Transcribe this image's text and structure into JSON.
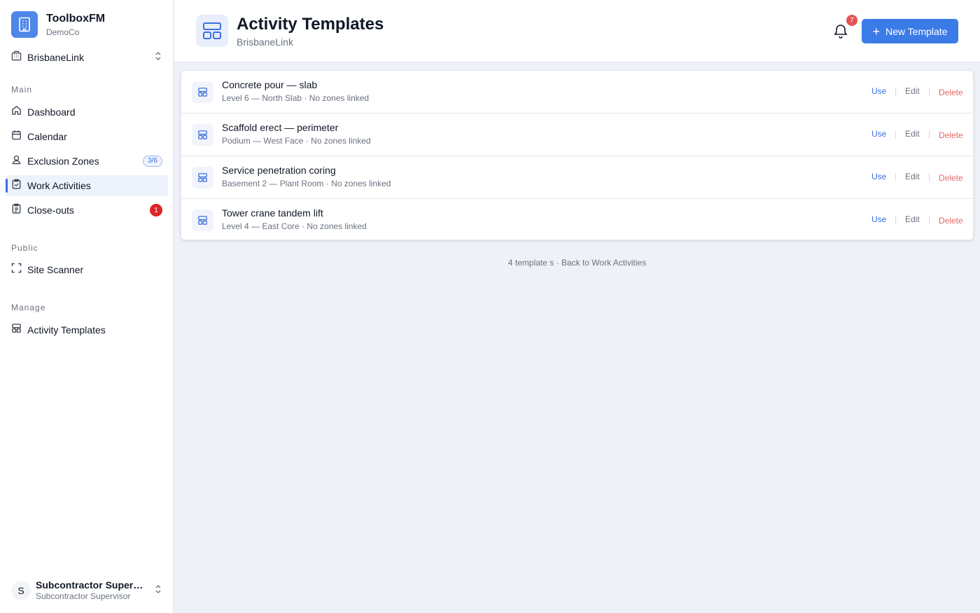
{
  "brand": {
    "name": "ToolboxFM",
    "org": "DemoCo",
    "accent": "#4f86e8"
  },
  "site_switch": {
    "label": "BrisbaneLink"
  },
  "sidebar": {
    "main_label": "Main",
    "main_items": [
      {
        "label": "Dashboard",
        "icon": "home-icon"
      },
      {
        "label": "Calendar",
        "icon": "calendar-icon"
      },
      {
        "label": "Exclusion Zones",
        "icon": "user-zone-icon",
        "pill": "3/6"
      },
      {
        "label": "Work Activities",
        "icon": "clipboard-check-icon",
        "active": true
      },
      {
        "label": "Close-outs",
        "icon": "clipboard-list-icon",
        "badge": "1"
      }
    ],
    "public_label": "Public",
    "public_items": [
      {
        "label": "Site Scanner",
        "icon": "scan-icon"
      }
    ],
    "manage_label": "Manage",
    "manage_items": [
      {
        "label": "Activity Templates",
        "icon": "template-icon"
      }
    ]
  },
  "user": {
    "initial": "S",
    "name": "Subcontractor Supervisor",
    "role": "Subcontractor Supervisor"
  },
  "header": {
    "title": "Activity Templates",
    "subtitle": "BrisbaneLink",
    "notification_count": "7",
    "new_button": "New Template"
  },
  "templates": [
    {
      "title": "Concrete pour — slab",
      "meta": "Level 6 — North Slab · No zones linked"
    },
    {
      "title": "Scaffold erect — perimeter",
      "meta": "Podium — West Face · No zones linked"
    },
    {
      "title": "Service penetration coring",
      "meta": "Basement 2 — Plant Room · No zones linked"
    },
    {
      "title": "Tower crane tandem lift",
      "meta": "Level 4 — East Core · No zones linked"
    }
  ],
  "actions": {
    "use": "Use",
    "edit": "Edit",
    "delete": "Delete",
    "separator": "|"
  },
  "footer": {
    "count_text": "4 template s",
    "dot": " · ",
    "back_link": "Back to Work Activities"
  }
}
